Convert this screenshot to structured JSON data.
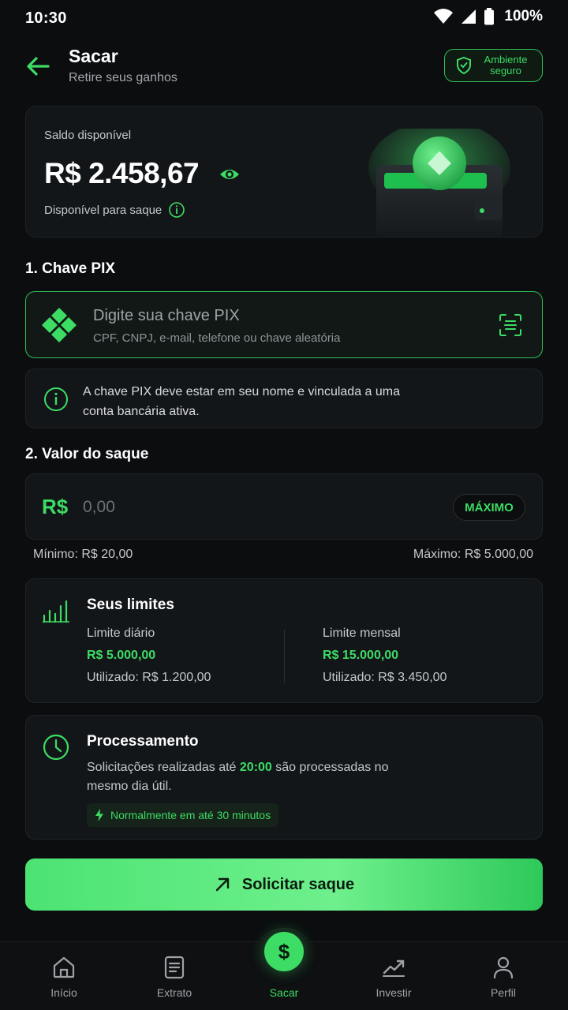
{
  "status_bar": {
    "time": "10:30",
    "battery": "100%"
  },
  "header": {
    "title": "Sacar",
    "subtitle": "Retire seus ganhos",
    "secure_badge": "Ambiente seguro"
  },
  "balance": {
    "label": "Saldo disponível",
    "amount": "R$ 2.458,67",
    "sub_label": "Disponível para saque"
  },
  "pix_section": {
    "title": "1. Chave PIX",
    "placeholder": "Digite sua chave PIX",
    "helper": "CPF, CNPJ, e-mail, telefone ou chave aleatória",
    "info": "A chave PIX deve estar em seu nome e vinculada a uma conta bancária ativa."
  },
  "amount_section": {
    "title": "2. Valor do saque",
    "currency": "R$",
    "placeholder": "0,00",
    "max_button": "MÁXIMO",
    "min_text": "Mínimo: R$ 20,00",
    "max_text": "Máximo: R$ 5.000,00"
  },
  "limits": {
    "title": "Seus limites",
    "daily": {
      "label": "Limite diário",
      "value": "R$ 5.000,00",
      "used": "Utilizado: R$ 1.200,00"
    },
    "monthly": {
      "label": "Limite mensal",
      "value": "R$ 15.000,00",
      "used": "Utilizado: R$ 3.450,00"
    }
  },
  "processing": {
    "title": "Processamento",
    "text_before": "Solicitações realizadas até ",
    "time": "20:00",
    "text_after": " são processadas no mesmo dia útil.",
    "badge": "Normalmente em até 30 minutos"
  },
  "submit_button": "Solicitar saque",
  "nav": [
    {
      "label": "Início",
      "icon": "home-icon"
    },
    {
      "label": "Extrato",
      "icon": "document-icon"
    },
    {
      "label": "Sacar",
      "icon": "dollar-icon"
    },
    {
      "label": "Investir",
      "icon": "trending-up-icon"
    },
    {
      "label": "Perfil",
      "icon": "user-icon"
    }
  ],
  "colors": {
    "accent": "#3ddc64",
    "background": "#0b0d0f",
    "card": "#131619"
  }
}
